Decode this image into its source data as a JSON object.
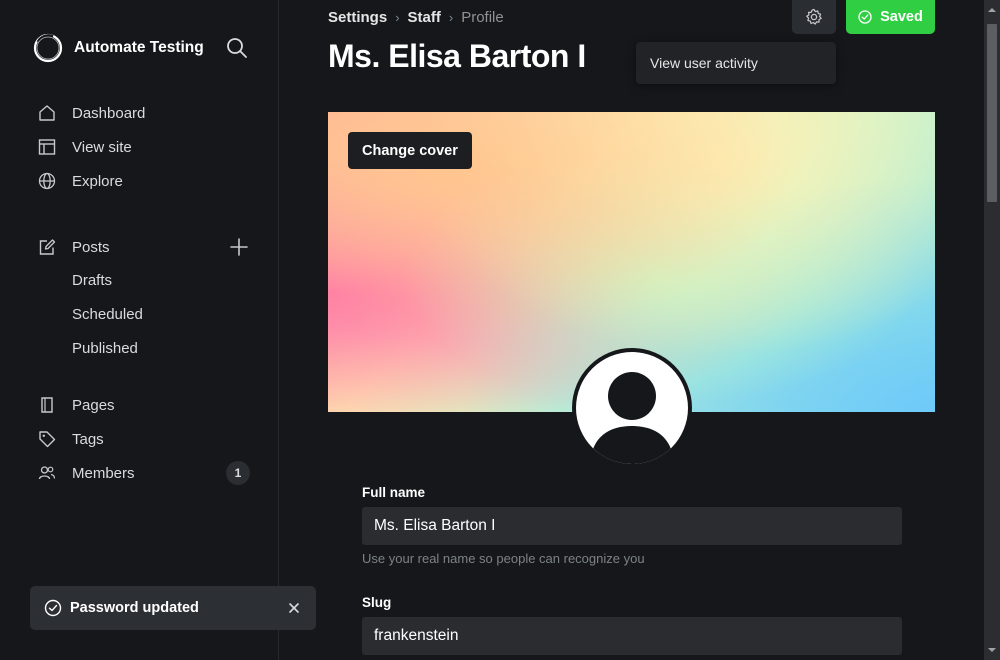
{
  "sidebar": {
    "brand_name": "Automate Testing",
    "nav": [
      {
        "label": "Dashboard",
        "icon": "home-icon"
      },
      {
        "label": "View site",
        "icon": "layout-icon"
      },
      {
        "label": "Explore",
        "icon": "globe-icon"
      },
      {
        "label": "Posts",
        "icon": "edit-icon"
      },
      {
        "label": "Pages",
        "icon": "page-icon"
      },
      {
        "label": "Tags",
        "icon": "tag-icon"
      },
      {
        "label": "Members",
        "icon": "members-icon"
      }
    ],
    "posts_sub": [
      "Drafts",
      "Scheduled",
      "Published"
    ],
    "members_count": "1"
  },
  "toast": {
    "message": "Password updated"
  },
  "header": {
    "breadcrumb": [
      "Settings",
      "Staff",
      "Profile"
    ],
    "title": "Ms. Elisa Barton I",
    "saved_label": "Saved",
    "dropdown_item": "View user activity"
  },
  "cover": {
    "change_cover_label": "Change cover"
  },
  "form": {
    "full_name": {
      "label": "Full name",
      "value": "Ms. Elisa Barton I",
      "hint": "Use your real name so people can recognize you"
    },
    "slug": {
      "label": "Slug",
      "value": "frankenstein"
    }
  },
  "colors": {
    "accent_green": "#30cf43",
    "background": "#15171a"
  }
}
